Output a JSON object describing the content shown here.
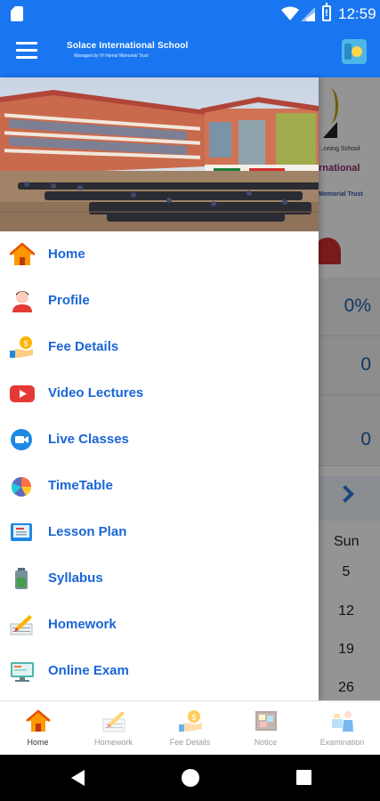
{
  "status_bar": {
    "time": "12:59"
  },
  "app_bar": {
    "title": "Solace International School",
    "subtitle": "Managed by Hi Hamal Memorial Trust"
  },
  "background": {
    "logo_line1": "...nning School",
    "logo_line2": "rnational",
    "logo_line3": "Memorial Trust",
    "cards": [
      "0%",
      "0",
      "0"
    ],
    "calendar_header": "Sun",
    "calendar_days": [
      "5",
      "12",
      "19",
      "26"
    ]
  },
  "drawer": {
    "menu_items": [
      {
        "label": "Home",
        "icon": "home-icon"
      },
      {
        "label": "Profile",
        "icon": "profile-icon"
      },
      {
        "label": "Fee Details",
        "icon": "fee-icon"
      },
      {
        "label": "Video Lectures",
        "icon": "youtube-icon"
      },
      {
        "label": "Live Classes",
        "icon": "video-camera-icon"
      },
      {
        "label": "TimeTable",
        "icon": "pie-chart-icon"
      },
      {
        "label": "Lesson Plan",
        "icon": "book-icon"
      },
      {
        "label": "Syllabus",
        "icon": "battery-icon"
      },
      {
        "label": "Homework",
        "icon": "pencil-notebook-icon"
      },
      {
        "label": "Online Exam",
        "icon": "monitor-icon"
      }
    ]
  },
  "bottom_nav": {
    "items": [
      {
        "label": "Home",
        "icon": "home-icon",
        "active": true
      },
      {
        "label": "Homework",
        "icon": "notebook-icon",
        "active": false
      },
      {
        "label": "Fee Details",
        "icon": "fee-icon",
        "active": false
      },
      {
        "label": "Notice",
        "icon": "notice-board-icon",
        "active": false
      },
      {
        "label": "Examination",
        "icon": "examination-icon",
        "active": false
      }
    ]
  },
  "colors": {
    "primary": "#1976f0",
    "menu_text": "#1a65d6",
    "nav_inactive": "#9a9a9a"
  }
}
